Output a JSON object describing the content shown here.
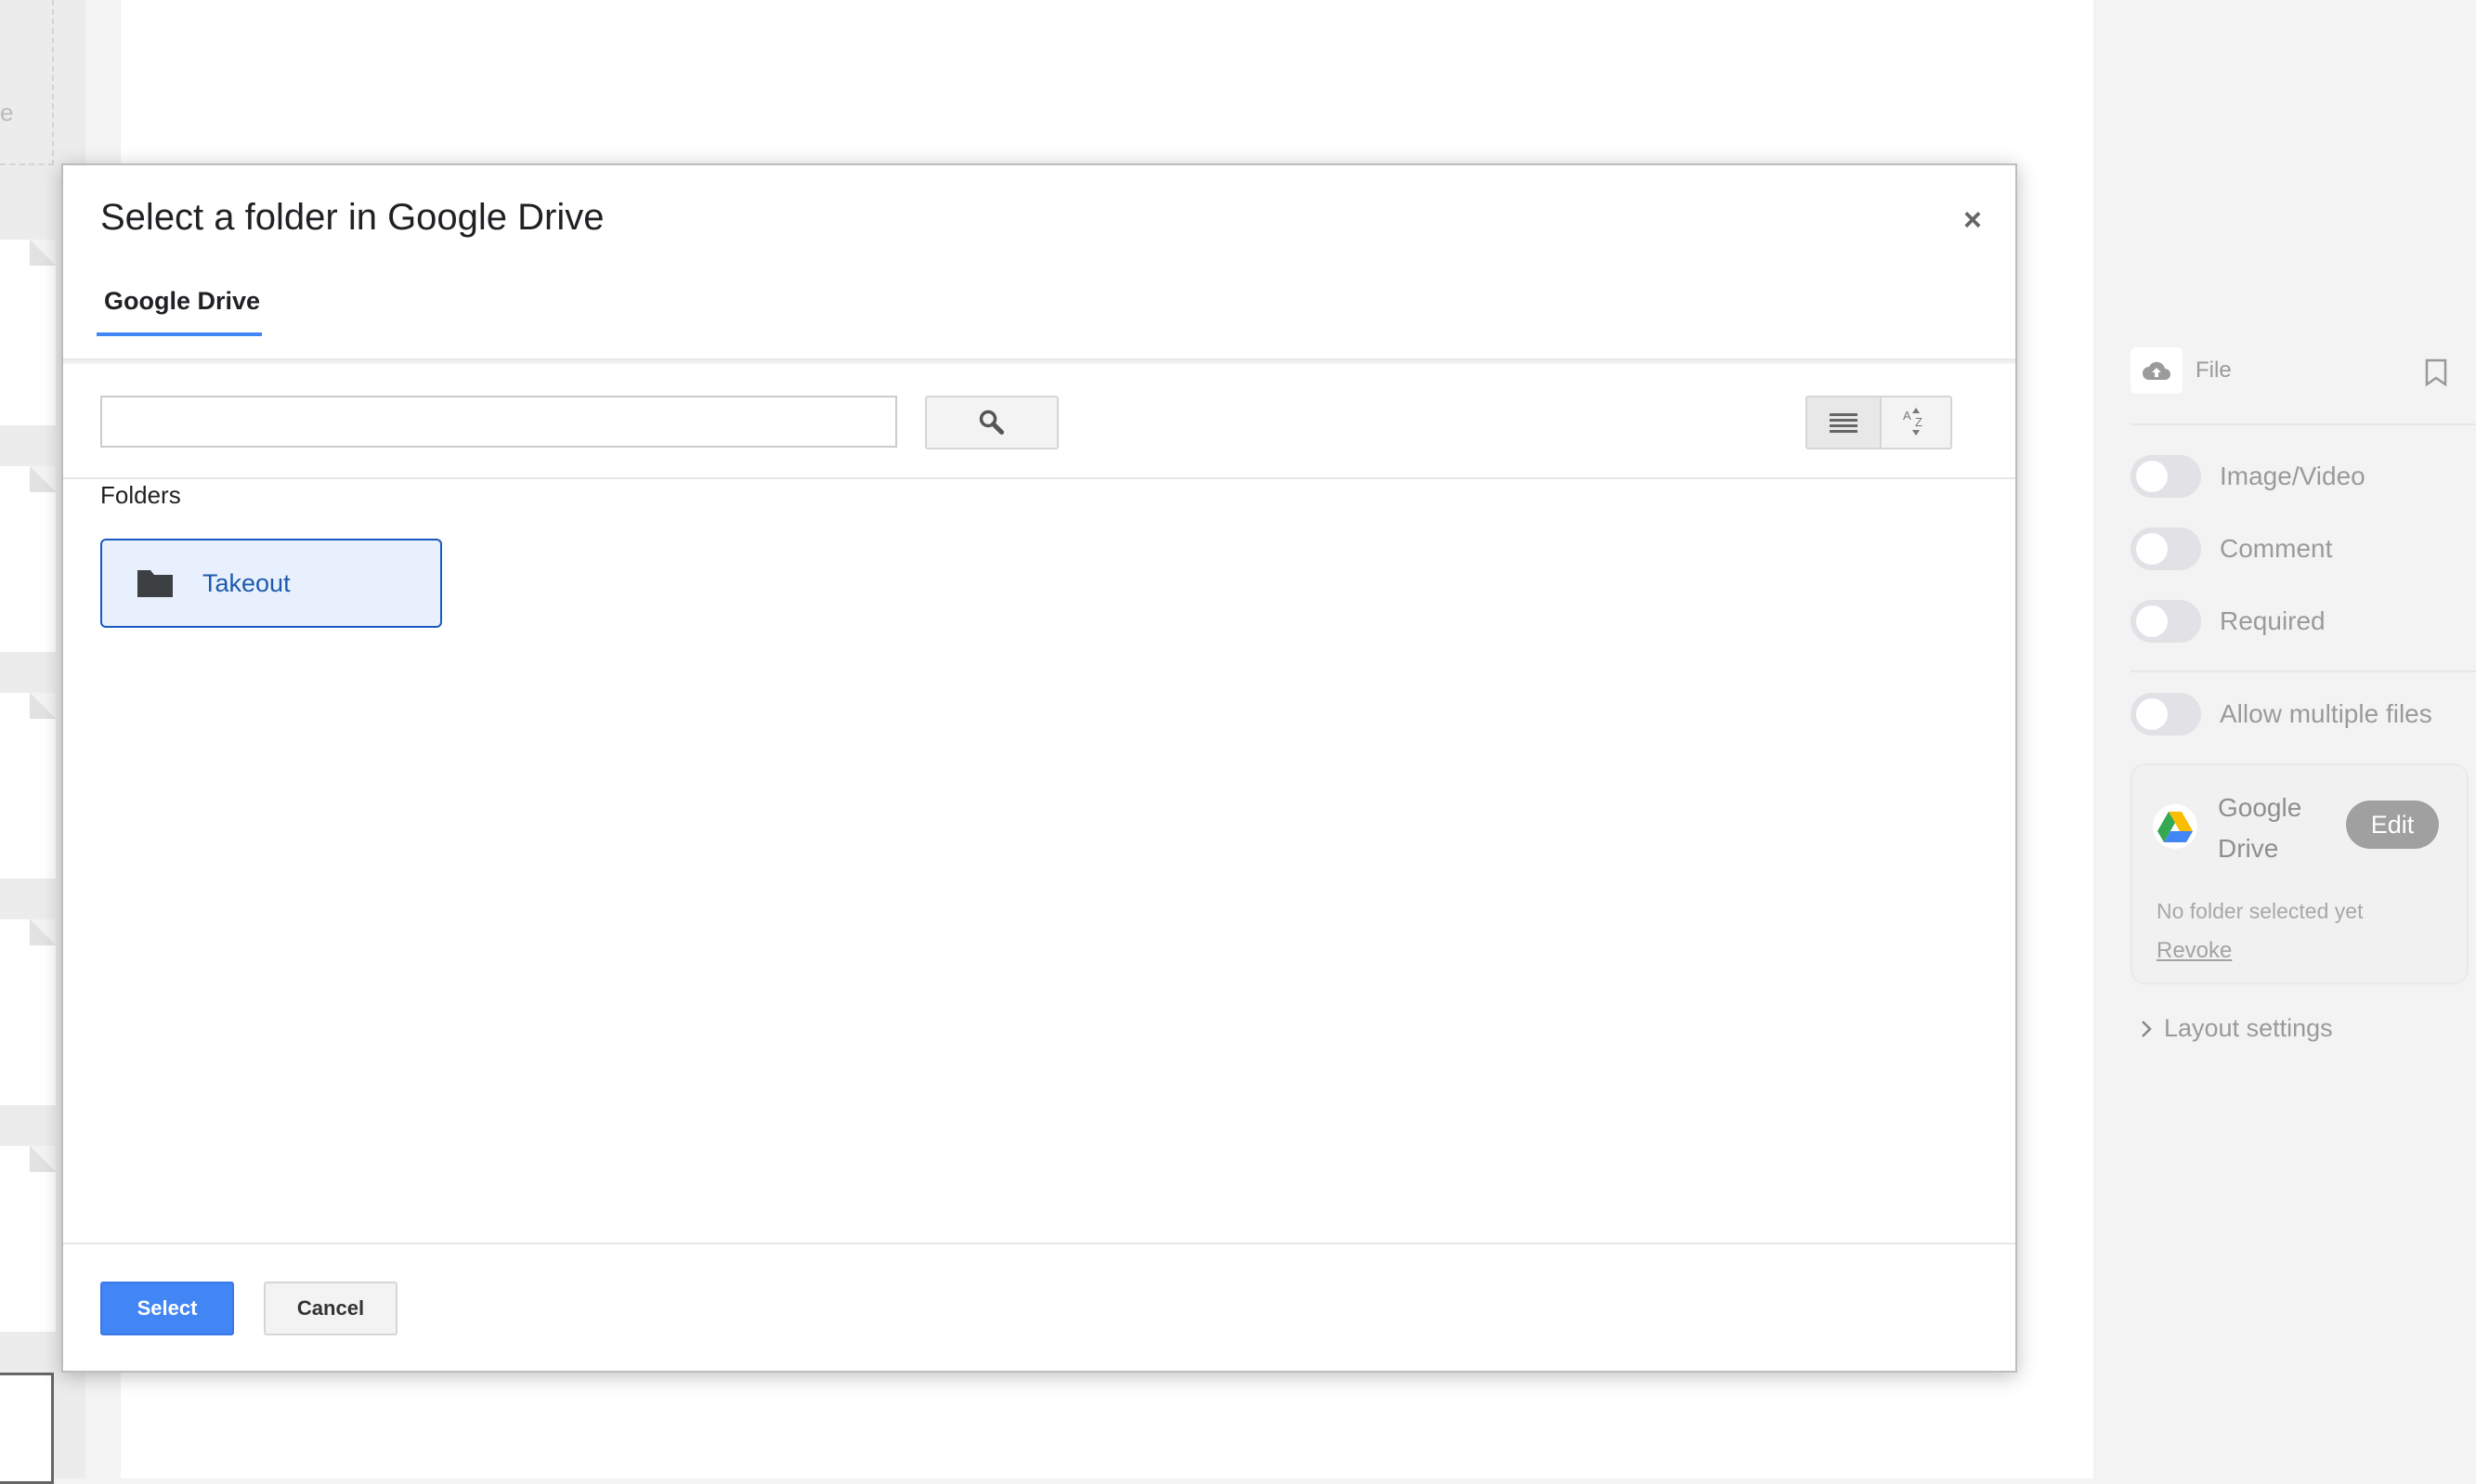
{
  "background": {
    "left_fragment": "e"
  },
  "dialog": {
    "title": "Select a folder in Google Drive",
    "close_symbol": "×",
    "tab_label": "Google Drive",
    "search": {
      "value": "",
      "placeholder": "",
      "button_icon": "search-icon"
    },
    "view_buttons": [
      "list-view-icon",
      "sort-az-icon"
    ],
    "section_heading": "Folders",
    "folders": [
      {
        "name": "Takeout",
        "icon": "folder-icon",
        "selected": true
      }
    ],
    "select_label": "Select",
    "cancel_label": "Cancel",
    "accent_color": "#4285f4"
  },
  "right_panel": {
    "file_label": "File",
    "file_icon": "cloud-upload-icon",
    "bookmark_icon": "bookmark-icon",
    "toggles": [
      {
        "label": "Image/Video",
        "on": false
      },
      {
        "label": "Comment",
        "on": false
      },
      {
        "label": "Required",
        "on": false
      },
      {
        "label": "Allow multiple files",
        "on": false
      }
    ],
    "drive_card": {
      "name": "Google Drive",
      "edit_label": "Edit",
      "status": "No folder selected yet",
      "revoke_label": "Revoke"
    },
    "layout_settings_label": "Layout settings"
  }
}
